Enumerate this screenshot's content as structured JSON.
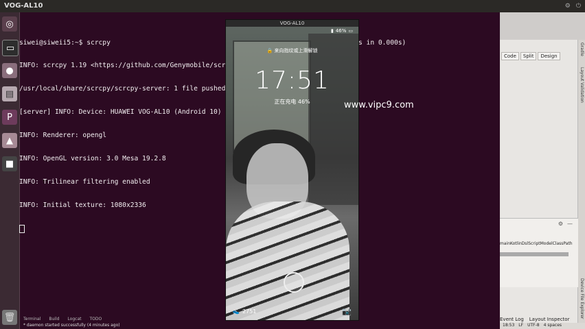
{
  "top_panel": {
    "window_title": "VOG-AL10",
    "tray": [
      "⚙",
      "⏻"
    ]
  },
  "ghost_tabs": [
    "",
    "",
    "",
    ""
  ],
  "terminal": {
    "lines": [
      "siwei@siweii5:~$ scrcpy",
      "INFO: scrcpy 1.19 <https://github.com/Genymobile/scr",
      "/usr/local/share/scrcpy/scrcpy-server: 1 file pushed",
      "[server] INFO: Device: HUAWEI VOG-AL10 (Android 10)",
      "INFO: Renderer: opengl",
      "INFO: OpenGL version: 3.0 Mesa 19.2.8",
      "INFO: Trilinear filtering enabled",
      "INFO: Initial texture: 1080x2336"
    ],
    "right_fragment": "s in 0.000s)"
  },
  "phone": {
    "title": "VOG-AL10",
    "status_right": "46%",
    "unlock_hint": "来向指纹或上滑解锁",
    "clock": "17:51",
    "charging": "正在充电 46%",
    "steps": "2751"
  },
  "watermark": "www.vipc9.com",
  "ide": {
    "view_tabs": [
      "Code",
      "Split",
      "Design"
    ],
    "side_labels": [
      "Gradle",
      "Layout Validation"
    ],
    "side_labels_lower": [
      "Device File Explorer"
    ],
    "class_path": "mainKotlinDslScriptModelClassPath",
    "event_log": "Event Log",
    "layout_inspector": "Layout Inspector",
    "status": [
      "18:53",
      "LF",
      "UTF-8",
      "4 spaces"
    ]
  },
  "bottom": {
    "tabs": [
      "Terminal",
      "Build",
      "Logcat",
      "TODO"
    ],
    "status_message": "* daemon started successfully (4 minutes ago)"
  }
}
